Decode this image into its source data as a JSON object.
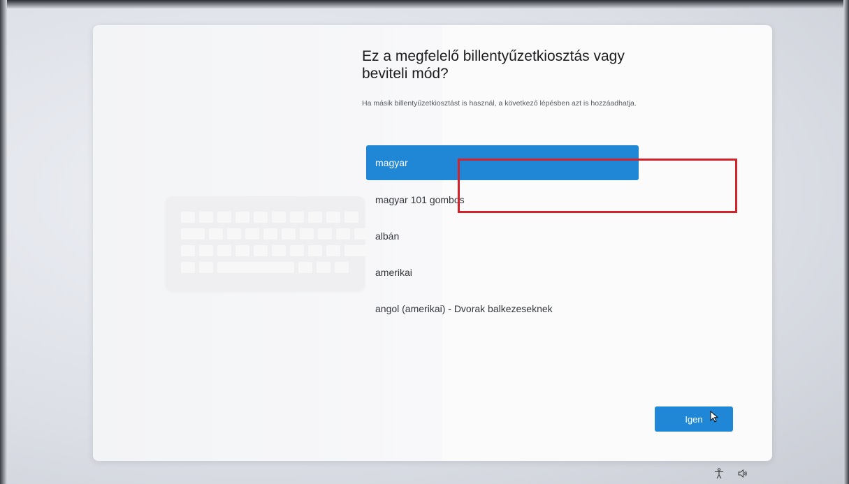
{
  "setup": {
    "title": "Ez a megfelelő billentyűzetkiosztás vagy beviteli mód?",
    "subtitle": "Ha másik billentyűzetkiosztást is használ, a következő lépésben azt is hozzáadhatja.",
    "layouts": [
      {
        "label": "magyar",
        "selected": true
      },
      {
        "label": "magyar 101 gombos",
        "selected": false
      },
      {
        "label": "albán",
        "selected": false
      },
      {
        "label": "amerikai",
        "selected": false
      },
      {
        "label": "angol (amerikai) - Dvorak balkezeseknek",
        "selected": false
      }
    ],
    "confirm_label": "Igen"
  },
  "tray": {
    "icons": [
      "accessibility-icon",
      "speaker-icon"
    ]
  },
  "colors": {
    "accent": "#1f87d6",
    "highlight_box": "#d2232a"
  }
}
